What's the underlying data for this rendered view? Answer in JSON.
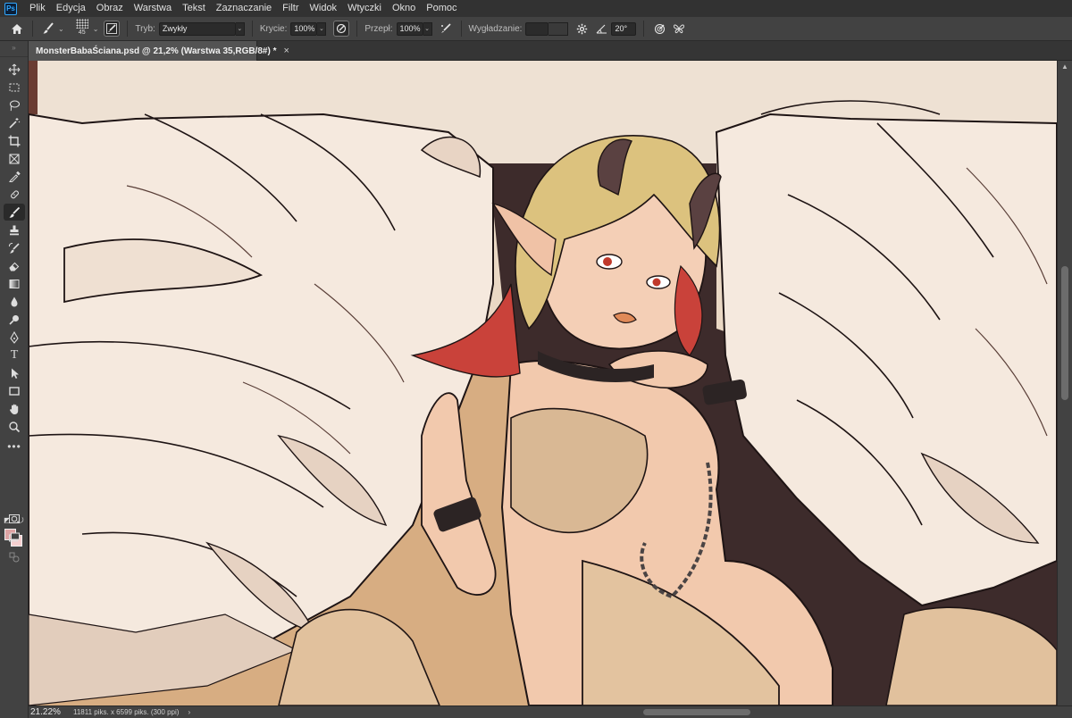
{
  "app": {
    "logo_text": "Ps",
    "menu": [
      "Plik",
      "Edycja",
      "Obraz",
      "Warstwa",
      "Tekst",
      "Zaznaczanie",
      "Filtr",
      "Widok",
      "Wtyczki",
      "Okno",
      "Pomoc"
    ]
  },
  "options_bar": {
    "brush_size": "45",
    "mode_label": "Tryb:",
    "mode_value": "Zwykły",
    "opacity_label": "Krycie:",
    "opacity_value": "100%",
    "flow_label": "Przepł:",
    "flow_value": "100%",
    "smoothing_label": "Wygładzanie:",
    "smoothing_value": "",
    "angle_value": "20°"
  },
  "document": {
    "tab_title": "MonsterBabaŚciana.psd @ 21,2% (Warstwa 35,RGB/8#) *",
    "close_glyph": "×"
  },
  "status": {
    "zoom": "21.22%",
    "info": "11811 piks. x 6599 piks. (300 ppi)",
    "arrow": "›"
  },
  "colors": {
    "foreground": "#dea4a4",
    "background": "#f6cfcf",
    "accent": "#31a8ff"
  },
  "tools": [
    "move-icon",
    "marquee-icon",
    "lasso-icon",
    "magic-wand-icon",
    "crop-icon",
    "frame-icon",
    "eyedropper-icon",
    "healing-brush-icon",
    "brush-icon",
    "stamp-icon",
    "history-brush-icon",
    "eraser-icon",
    "gradient-icon",
    "blur-icon",
    "dodge-icon",
    "pen-icon",
    "type-icon",
    "path-select-icon",
    "rectangle-icon",
    "hand-icon",
    "zoom-icon",
    "more-tools-icon"
  ]
}
